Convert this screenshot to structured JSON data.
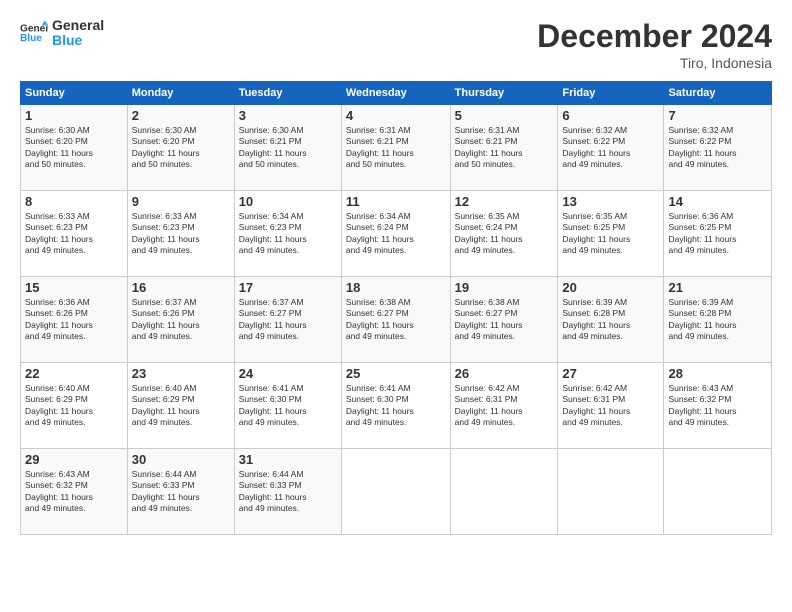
{
  "logo": {
    "text_general": "General",
    "text_blue": "Blue"
  },
  "header": {
    "title": "December 2024",
    "location": "Tiro, Indonesia"
  },
  "days_of_week": [
    "Sunday",
    "Monday",
    "Tuesday",
    "Wednesday",
    "Thursday",
    "Friday",
    "Saturday"
  ],
  "weeks": [
    [
      {
        "day": "1",
        "sunrise": "6:30 AM",
        "sunset": "6:20 PM",
        "daylight": "11 hours and 50 minutes."
      },
      {
        "day": "2",
        "sunrise": "6:30 AM",
        "sunset": "6:20 PM",
        "daylight": "11 hours and 50 minutes."
      },
      {
        "day": "3",
        "sunrise": "6:30 AM",
        "sunset": "6:21 PM",
        "daylight": "11 hours and 50 minutes."
      },
      {
        "day": "4",
        "sunrise": "6:31 AM",
        "sunset": "6:21 PM",
        "daylight": "11 hours and 50 minutes."
      },
      {
        "day": "5",
        "sunrise": "6:31 AM",
        "sunset": "6:21 PM",
        "daylight": "11 hours and 50 minutes."
      },
      {
        "day": "6",
        "sunrise": "6:32 AM",
        "sunset": "6:22 PM",
        "daylight": "11 hours and 49 minutes."
      },
      {
        "day": "7",
        "sunrise": "6:32 AM",
        "sunset": "6:22 PM",
        "daylight": "11 hours and 49 minutes."
      }
    ],
    [
      {
        "day": "8",
        "sunrise": "6:33 AM",
        "sunset": "6:23 PM",
        "daylight": "11 hours and 49 minutes."
      },
      {
        "day": "9",
        "sunrise": "6:33 AM",
        "sunset": "6:23 PM",
        "daylight": "11 hours and 49 minutes."
      },
      {
        "day": "10",
        "sunrise": "6:34 AM",
        "sunset": "6:23 PM",
        "daylight": "11 hours and 49 minutes."
      },
      {
        "day": "11",
        "sunrise": "6:34 AM",
        "sunset": "6:24 PM",
        "daylight": "11 hours and 49 minutes."
      },
      {
        "day": "12",
        "sunrise": "6:35 AM",
        "sunset": "6:24 PM",
        "daylight": "11 hours and 49 minutes."
      },
      {
        "day": "13",
        "sunrise": "6:35 AM",
        "sunset": "6:25 PM",
        "daylight": "11 hours and 49 minutes."
      },
      {
        "day": "14",
        "sunrise": "6:36 AM",
        "sunset": "6:25 PM",
        "daylight": "11 hours and 49 minutes."
      }
    ],
    [
      {
        "day": "15",
        "sunrise": "6:36 AM",
        "sunset": "6:26 PM",
        "daylight": "11 hours and 49 minutes."
      },
      {
        "day": "16",
        "sunrise": "6:37 AM",
        "sunset": "6:26 PM",
        "daylight": "11 hours and 49 minutes."
      },
      {
        "day": "17",
        "sunrise": "6:37 AM",
        "sunset": "6:27 PM",
        "daylight": "11 hours and 49 minutes."
      },
      {
        "day": "18",
        "sunrise": "6:38 AM",
        "sunset": "6:27 PM",
        "daylight": "11 hours and 49 minutes."
      },
      {
        "day": "19",
        "sunrise": "6:38 AM",
        "sunset": "6:27 PM",
        "daylight": "11 hours and 49 minutes."
      },
      {
        "day": "20",
        "sunrise": "6:39 AM",
        "sunset": "6:28 PM",
        "daylight": "11 hours and 49 minutes."
      },
      {
        "day": "21",
        "sunrise": "6:39 AM",
        "sunset": "6:28 PM",
        "daylight": "11 hours and 49 minutes."
      }
    ],
    [
      {
        "day": "22",
        "sunrise": "6:40 AM",
        "sunset": "6:29 PM",
        "daylight": "11 hours and 49 minutes."
      },
      {
        "day": "23",
        "sunrise": "6:40 AM",
        "sunset": "6:29 PM",
        "daylight": "11 hours and 49 minutes."
      },
      {
        "day": "24",
        "sunrise": "6:41 AM",
        "sunset": "6:30 PM",
        "daylight": "11 hours and 49 minutes."
      },
      {
        "day": "25",
        "sunrise": "6:41 AM",
        "sunset": "6:30 PM",
        "daylight": "11 hours and 49 minutes."
      },
      {
        "day": "26",
        "sunrise": "6:42 AM",
        "sunset": "6:31 PM",
        "daylight": "11 hours and 49 minutes."
      },
      {
        "day": "27",
        "sunrise": "6:42 AM",
        "sunset": "6:31 PM",
        "daylight": "11 hours and 49 minutes."
      },
      {
        "day": "28",
        "sunrise": "6:43 AM",
        "sunset": "6:32 PM",
        "daylight": "11 hours and 49 minutes."
      }
    ],
    [
      {
        "day": "29",
        "sunrise": "6:43 AM",
        "sunset": "6:32 PM",
        "daylight": "11 hours and 49 minutes."
      },
      {
        "day": "30",
        "sunrise": "6:44 AM",
        "sunset": "6:33 PM",
        "daylight": "11 hours and 49 minutes."
      },
      {
        "day": "31",
        "sunrise": "6:44 AM",
        "sunset": "6:33 PM",
        "daylight": "11 hours and 49 minutes."
      },
      null,
      null,
      null,
      null
    ]
  ],
  "labels": {
    "sunrise": "Sunrise: ",
    "sunset": "Sunset: ",
    "daylight": "Daylight: "
  }
}
